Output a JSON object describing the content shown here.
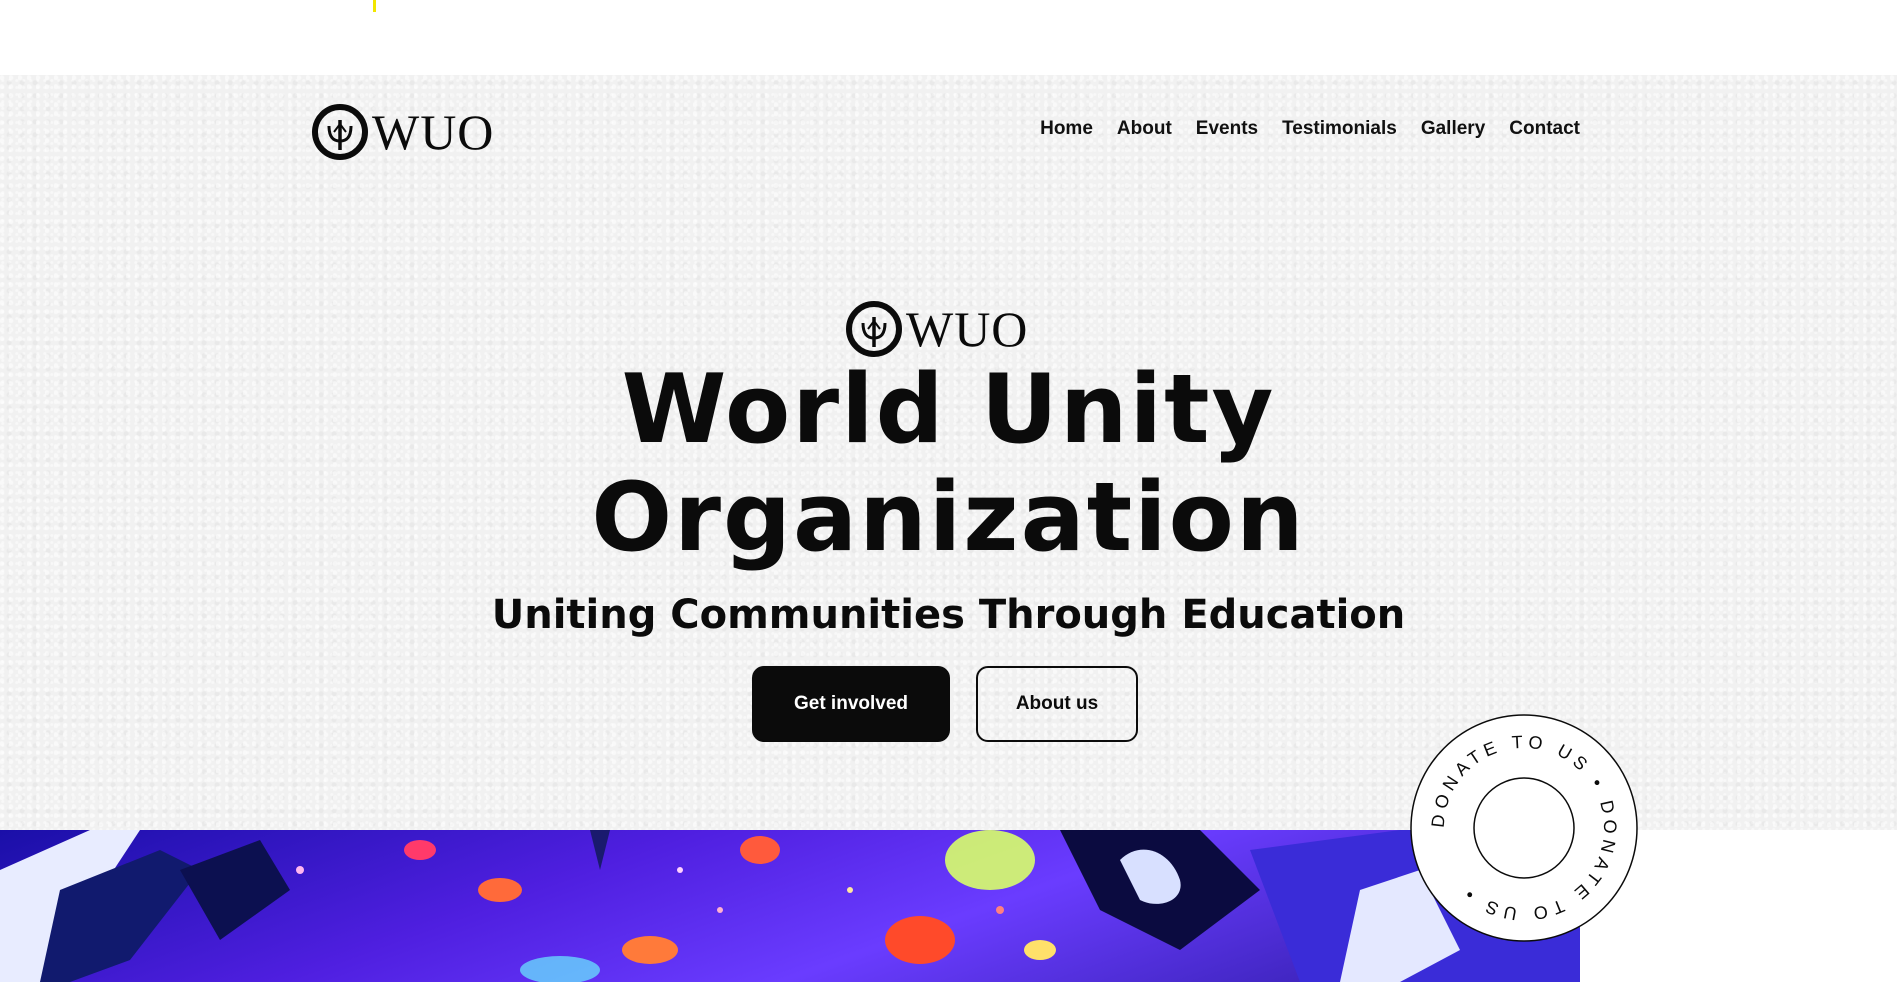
{
  "header": {
    "logo_text": "WUO",
    "nav": [
      "Home",
      "About",
      "Events",
      "Testimonials",
      "Gallery",
      "Contact"
    ]
  },
  "hero": {
    "logo_text": "WUO",
    "title_line1": "World Unity",
    "title_line2": "Organization",
    "subtitle": "Uniting Communities Through Education",
    "primary_button": "Get involved",
    "secondary_button": "About us"
  },
  "donate_badge": {
    "text": "DONATE TO US • DONATE TO US •"
  },
  "icons": {
    "logo_mark": "trident-circle-icon"
  },
  "colors": {
    "background": "#f1f1f1",
    "text": "#0b0b0b",
    "primary_button": "#0b0b0b",
    "accent_gallery": "#4f1fe0"
  }
}
